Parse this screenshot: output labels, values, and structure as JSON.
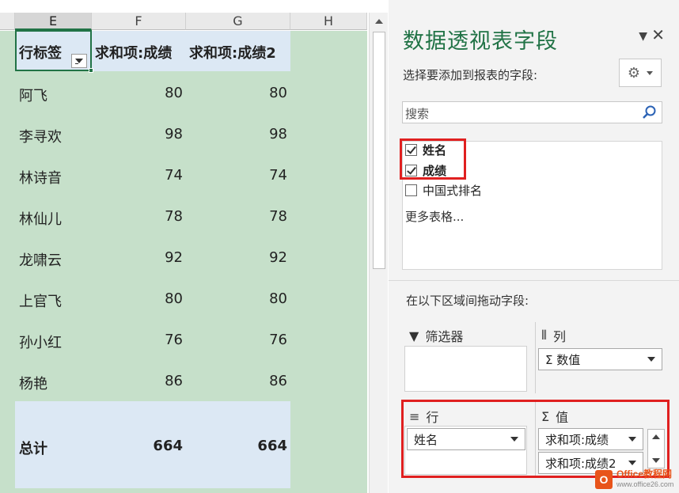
{
  "sheet": {
    "columns": [
      {
        "label": "E",
        "selected": true
      },
      {
        "label": "F",
        "selected": false
      },
      {
        "label": "G",
        "selected": false
      },
      {
        "label": "H",
        "selected": false
      }
    ],
    "pivot": {
      "row_label_header": "行标签",
      "sum_header_1": "求和项:成绩",
      "sum_header_2": "求和项:成绩2",
      "rows": [
        {
          "name": "阿飞",
          "v1": "80",
          "v2": "80"
        },
        {
          "name": "李寻欢",
          "v1": "98",
          "v2": "98"
        },
        {
          "name": "林诗音",
          "v1": "74",
          "v2": "74"
        },
        {
          "name": "林仙儿",
          "v1": "78",
          "v2": "78"
        },
        {
          "name": "龙啸云",
          "v1": "92",
          "v2": "92"
        },
        {
          "name": "上官飞",
          "v1": "80",
          "v2": "80"
        },
        {
          "name": "孙小红",
          "v1": "76",
          "v2": "76"
        },
        {
          "name": "杨艳",
          "v1": "86",
          "v2": "86"
        }
      ],
      "total": {
        "label": "总计",
        "v1": "664",
        "v2": "664"
      }
    },
    "colors": {
      "background": "#c6e0ca",
      "header_band": "#dce8f4",
      "selection": "#217346"
    }
  },
  "panel": {
    "title": "数据透视表字段",
    "subtitle": "选择要添加到报表的字段:",
    "gear_icon": "gear-icon",
    "search_placeholder": "搜索",
    "fields": [
      {
        "label": "姓名",
        "checked": true
      },
      {
        "label": "成绩",
        "checked": true
      },
      {
        "label": "中国式排名",
        "checked": false
      }
    ],
    "more_tables": "更多表格...",
    "drag_hint": "在以下区域间拖动字段:",
    "areas": {
      "filters": {
        "label": "筛选器",
        "items": []
      },
      "columns": {
        "label": "列",
        "items": [
          "Σ 数值"
        ]
      },
      "rows": {
        "label": "行",
        "items": [
          "姓名"
        ]
      },
      "values": {
        "label": "值",
        "items": [
          "求和项:成绩",
          "求和项:成绩2"
        ]
      }
    },
    "title_color": "#217346",
    "highlight_color": "#e02020"
  },
  "watermark": {
    "logo": "O",
    "name": "Office教程网",
    "url": "www.office26.com"
  }
}
